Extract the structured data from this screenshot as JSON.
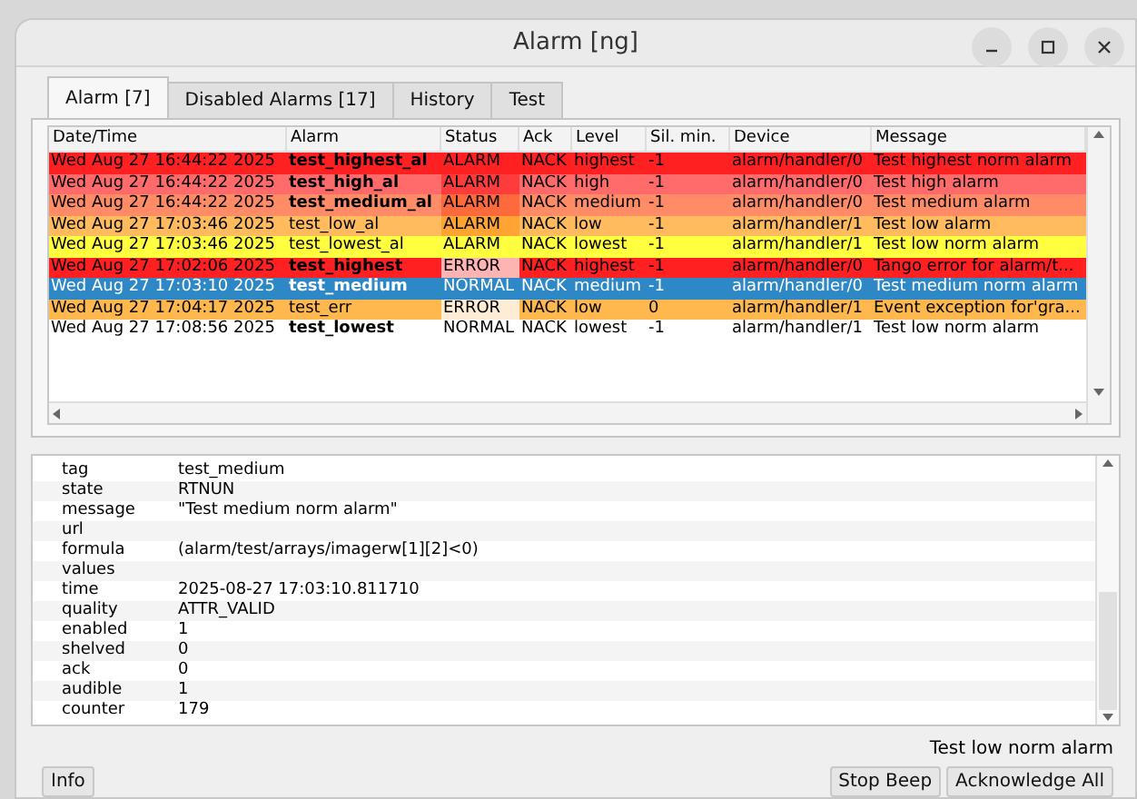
{
  "window": {
    "title": "Alarm [ng]"
  },
  "tabs": [
    {
      "label": "Alarm [7]",
      "selected": true
    },
    {
      "label": "Disabled Alarms [17]",
      "selected": false
    },
    {
      "label": "History",
      "selected": false
    },
    {
      "label": "Test",
      "selected": false
    }
  ],
  "table": {
    "columns": [
      "Date/Time",
      "Alarm",
      "Status",
      "Ack",
      "Level",
      "Sil. min.",
      "Device",
      "Message"
    ],
    "rows": [
      {
        "datetime": "Wed Aug 27 16:44:22 2025",
        "alarm": "test_highest_al",
        "bold": true,
        "status": {
          "text": "ALARM",
          "color": "#ff2121"
        },
        "ack": "NACK",
        "level": "highest",
        "sil_min": "-1",
        "device": "alarm/handler/0",
        "message": "Test highest norm alarm",
        "color": "#ff2121",
        "selected": false
      },
      {
        "datetime": "Wed Aug 27 16:44:22 2025",
        "alarm": "test_high_al",
        "bold": true,
        "status": {
          "text": "ALARM",
          "color": "#ff3c3c"
        },
        "ack": "NACK",
        "level": "high",
        "sil_min": "-1",
        "device": "alarm/handler/0",
        "message": "Test high alarm",
        "color": "#ff6a6a",
        "selected": false
      },
      {
        "datetime": "Wed Aug 27 16:44:22 2025",
        "alarm": "test_medium_al",
        "bold": true,
        "status": {
          "text": "ALARM",
          "color": "#ff6a3c"
        },
        "ack": "NACK",
        "level": "medium",
        "sil_min": "-1",
        "device": "alarm/handler/0",
        "message": "Test medium alarm",
        "color": "#ff8c66",
        "selected": false
      },
      {
        "datetime": "Wed Aug 27 17:03:46 2025",
        "alarm": "test_low_al",
        "bold": false,
        "status": {
          "text": "ALARM",
          "color": "#ffa432"
        },
        "ack": "NACK",
        "level": "low",
        "sil_min": "-1",
        "device": "alarm/handler/1",
        "message": "Test low alarm",
        "color": "#ffbb5e",
        "selected": false
      },
      {
        "datetime": "Wed Aug 27 17:03:46 2025",
        "alarm": "test_lowest_al",
        "bold": false,
        "status": {
          "text": "ALARM",
          "color": "#ffff40"
        },
        "ack": "NACK",
        "level": "lowest",
        "sil_min": "-1",
        "device": "alarm/handler/1",
        "message": "Test low norm alarm",
        "color": "#ffff40",
        "selected": false
      },
      {
        "datetime": "Wed Aug 27 17:02:06 2025",
        "alarm": "test_highest",
        "bold": true,
        "status": {
          "text": "ERROR",
          "color": "#ffb4b4"
        },
        "ack": "NACK",
        "level": "highest",
        "sil_min": "-1",
        "device": "alarm/handler/0",
        "message": "Tango error for alarm/t...",
        "color": "#ff2121",
        "selected": false
      },
      {
        "datetime": "Wed Aug 27 17:03:10 2025",
        "alarm": "test_medium",
        "bold": true,
        "status": {
          "text": "NORMAL"
        },
        "ack": "NACK",
        "level": "medium",
        "sil_min": "-1",
        "device": "alarm/handler/0",
        "message": "Test medium norm alarm",
        "selected": true
      },
      {
        "datetime": "Wed Aug 27 17:04:17 2025",
        "alarm": "test_err",
        "bold": false,
        "status": {
          "text": "ERROR",
          "color": "#ffecd4"
        },
        "ack": "NACK",
        "level": "low",
        "sil_min": "0",
        "device": "alarm/handler/1",
        "message": "Event exception for'gra...",
        "color": "#ffb84e",
        "selected": false
      },
      {
        "datetime": "Wed Aug 27 17:08:56 2025",
        "alarm": "test_lowest",
        "bold": true,
        "status": {
          "text": "NORMAL",
          "color": "#ffffff"
        },
        "ack": "NACK",
        "level": "lowest",
        "sil_min": "-1",
        "device": "alarm/handler/1",
        "message": "Test low norm alarm",
        "color": "#ffffff",
        "selected": false
      }
    ]
  },
  "details": [
    {
      "key": "tag",
      "value": "test_medium"
    },
    {
      "key": "state",
      "value": "RTNUN"
    },
    {
      "key": "message",
      "value": "\"Test medium norm alarm\""
    },
    {
      "key": "url"
    },
    {
      "key": "formula",
      "value": "(alarm/test/arrays/imagerw[1][2]<0)"
    },
    {
      "key": "values"
    },
    {
      "key": "time",
      "value": "2025-08-27  17:03:10.811710"
    },
    {
      "key": "quality",
      "value": "ATTR_VALID"
    },
    {
      "key": "enabled",
      "value": "1"
    },
    {
      "key": "shelved",
      "value": "0"
    },
    {
      "key": "ack",
      "value": "0"
    },
    {
      "key": "audible",
      "value": "1"
    },
    {
      "key": "counter",
      "value": "179"
    }
  ],
  "status_text": "Test low norm alarm",
  "buttons": {
    "left": [
      "Info"
    ],
    "right": [
      "Stop Beep",
      "Acknowledge All"
    ]
  }
}
